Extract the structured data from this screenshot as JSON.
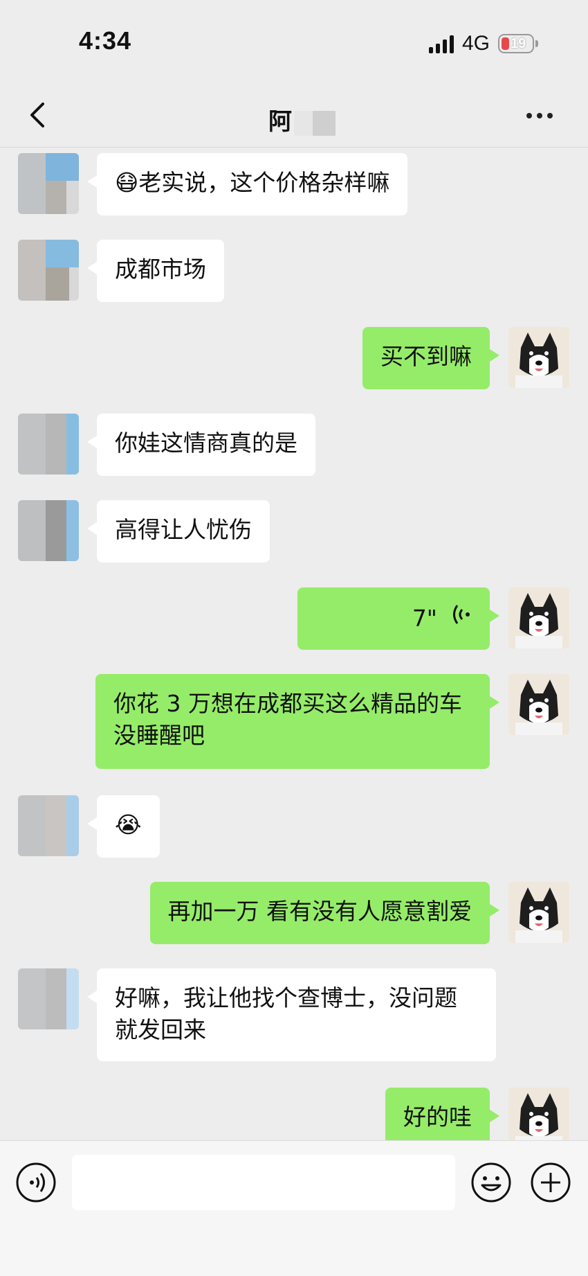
{
  "status": {
    "time": "4:34",
    "network": "4G",
    "battery": "19"
  },
  "header": {
    "title": "阿"
  },
  "messages": [
    {
      "side": "in",
      "type": "text",
      "text": "老实说，这个价格杂样嘛",
      "emoji": "😷"
    },
    {
      "side": "in",
      "type": "text",
      "text": "成都市场"
    },
    {
      "side": "out",
      "type": "text",
      "text": "买不到嘛"
    },
    {
      "side": "in",
      "type": "text",
      "text": "你娃这情商真的是"
    },
    {
      "side": "in",
      "type": "text",
      "text": "高得让人忧伤"
    },
    {
      "side": "out",
      "type": "voice",
      "duration": "7\""
    },
    {
      "side": "out",
      "type": "text",
      "text": "你花 3 万想在成都买这么精品的车 没睡醒吧"
    },
    {
      "side": "in",
      "type": "emoji",
      "emoji": "😭"
    },
    {
      "side": "out",
      "type": "text",
      "text": "再加一万 看有没有人愿意割爱"
    },
    {
      "side": "in",
      "type": "text",
      "text": "好嘛，我让他找个查博士，没问题就发回来"
    },
    {
      "side": "out",
      "type": "text",
      "text": "好的哇"
    }
  ],
  "input": {
    "value": ""
  },
  "icons": {
    "back": "chevron-left-icon",
    "more": "more-icon",
    "voice": "voice-input-icon",
    "emoji": "emoji-icon",
    "plus": "plus-icon"
  },
  "colors": {
    "out_bubble": "#95ec69",
    "in_bubble": "#ffffff",
    "background": "#ededed"
  }
}
